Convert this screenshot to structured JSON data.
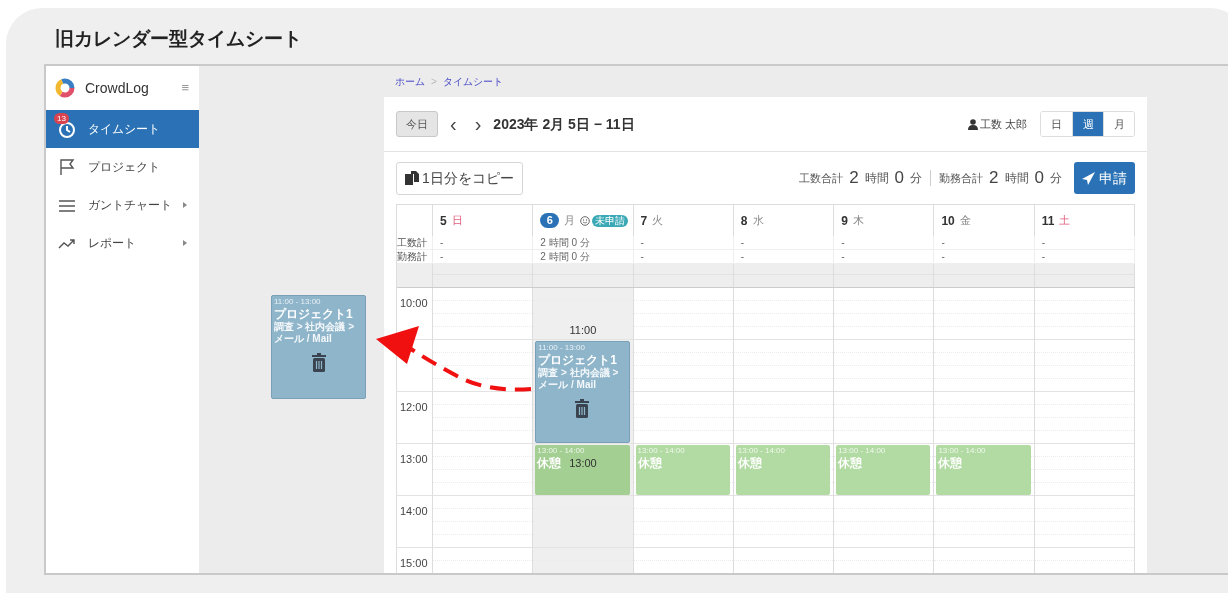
{
  "heading": "旧カレンダー型タイムシート",
  "sidebar": {
    "brand": "CrowdLog",
    "menu_glyph": "≡",
    "items": [
      {
        "label": "タイムシート",
        "badge": "13",
        "selected": true,
        "has_submenu": false
      },
      {
        "label": "プロジェクト",
        "selected": false,
        "has_submenu": false
      },
      {
        "label": "ガントチャート",
        "selected": false,
        "has_submenu": true
      },
      {
        "label": "レポート",
        "selected": false,
        "has_submenu": true
      }
    ]
  },
  "breadcrumb": {
    "items": [
      "ホーム",
      "タイムシート"
    ],
    "separator": ">"
  },
  "toolbar": {
    "today_button": "今日",
    "prev": "‹",
    "next": "›",
    "range": "2023年 2月 5日 − 11日",
    "user": "工数 太郎",
    "views": [
      {
        "label": "日",
        "selected": false
      },
      {
        "label": "週",
        "selected": true
      },
      {
        "label": "月",
        "selected": false
      }
    ]
  },
  "actions": {
    "copy_button": "1日分をコピー",
    "totals": [
      {
        "label": "工数合計",
        "hours": "2",
        "hours_unit": "時間",
        "minutes": "0",
        "minutes_unit": "分"
      },
      {
        "label": "勤務合計",
        "hours": "2",
        "hours_unit": "時間",
        "minutes": "0",
        "minutes_unit": "分"
      }
    ],
    "submit_button": "申請"
  },
  "calendar": {
    "row_labels": [
      "工数計",
      "勤務計"
    ],
    "days": [
      {
        "number": "5",
        "weekday": "日",
        "weekend": true,
        "today": false,
        "selected": false,
        "totals": [
          "-",
          "-"
        ]
      },
      {
        "number": "6",
        "weekday": "月",
        "weekend": false,
        "today": true,
        "selected": true,
        "status": "未申請",
        "totals": [
          "2 時間 0 分",
          "2 時間 0 分"
        ],
        "events": [
          {
            "kind": "work",
            "time": "11:00 - 13:00",
            "title": "プロジェクト1",
            "path": "調査 > 社内会議 > メール / Mail",
            "drag_start_label": "11:00",
            "drag_end_label": "13:00"
          },
          {
            "kind": "break",
            "time": "13:00 - 14:00",
            "title": "休憩"
          }
        ]
      },
      {
        "number": "7",
        "weekday": "火",
        "weekend": false,
        "today": false,
        "selected": false,
        "totals": [
          "-",
          "-"
        ],
        "events": [
          {
            "kind": "break",
            "time": "13:00 - 14:00",
            "title": "休憩"
          }
        ]
      },
      {
        "number": "8",
        "weekday": "水",
        "weekend": false,
        "today": false,
        "selected": false,
        "totals": [
          "-",
          "-"
        ],
        "events": [
          {
            "kind": "break",
            "time": "13:00 - 14:00",
            "title": "休憩"
          }
        ]
      },
      {
        "number": "9",
        "weekday": "木",
        "weekend": false,
        "today": false,
        "selected": false,
        "totals": [
          "-",
          "-"
        ],
        "events": [
          {
            "kind": "break",
            "time": "13:00 - 14:00",
            "title": "休憩"
          }
        ]
      },
      {
        "number": "10",
        "weekday": "金",
        "weekend": false,
        "today": false,
        "selected": false,
        "totals": [
          "-",
          "-"
        ],
        "events": [
          {
            "kind": "break",
            "time": "13:00 - 14:00",
            "title": "休憩"
          }
        ]
      },
      {
        "number": "11",
        "weekday": "土",
        "weekend": true,
        "today": false,
        "selected": false,
        "totals": [
          "-",
          "-"
        ]
      }
    ],
    "hours": [
      "10:00",
      "12:00",
      "13:00",
      "14:00",
      "15:00"
    ]
  },
  "dragged_card": {
    "time": "11:00 - 13:00",
    "title": "プロジェクト1",
    "path": "調査 > 社内会議 > メール / Mail"
  }
}
